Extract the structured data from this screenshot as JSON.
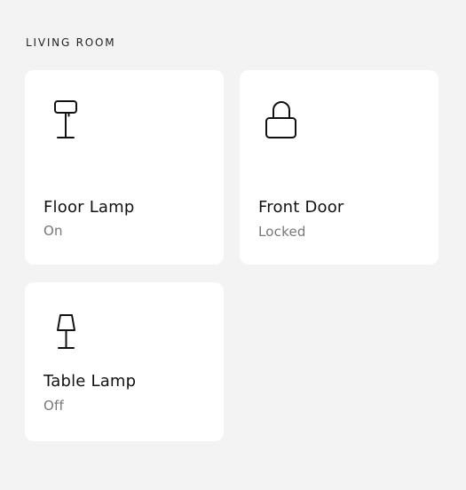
{
  "section": {
    "title": "LIVING ROOM"
  },
  "devices": [
    {
      "name": "Floor Lamp",
      "status": "On",
      "icon": "floor-lamp-icon"
    },
    {
      "name": "Front Door",
      "status": "Locked",
      "icon": "lock-icon"
    },
    {
      "name": "Table Lamp",
      "status": "Off",
      "icon": "table-lamp-icon"
    }
  ],
  "colors": {
    "background": "#f3f3f3",
    "card": "#ffffff",
    "text_primary": "#111111",
    "text_secondary": "#777777"
  }
}
